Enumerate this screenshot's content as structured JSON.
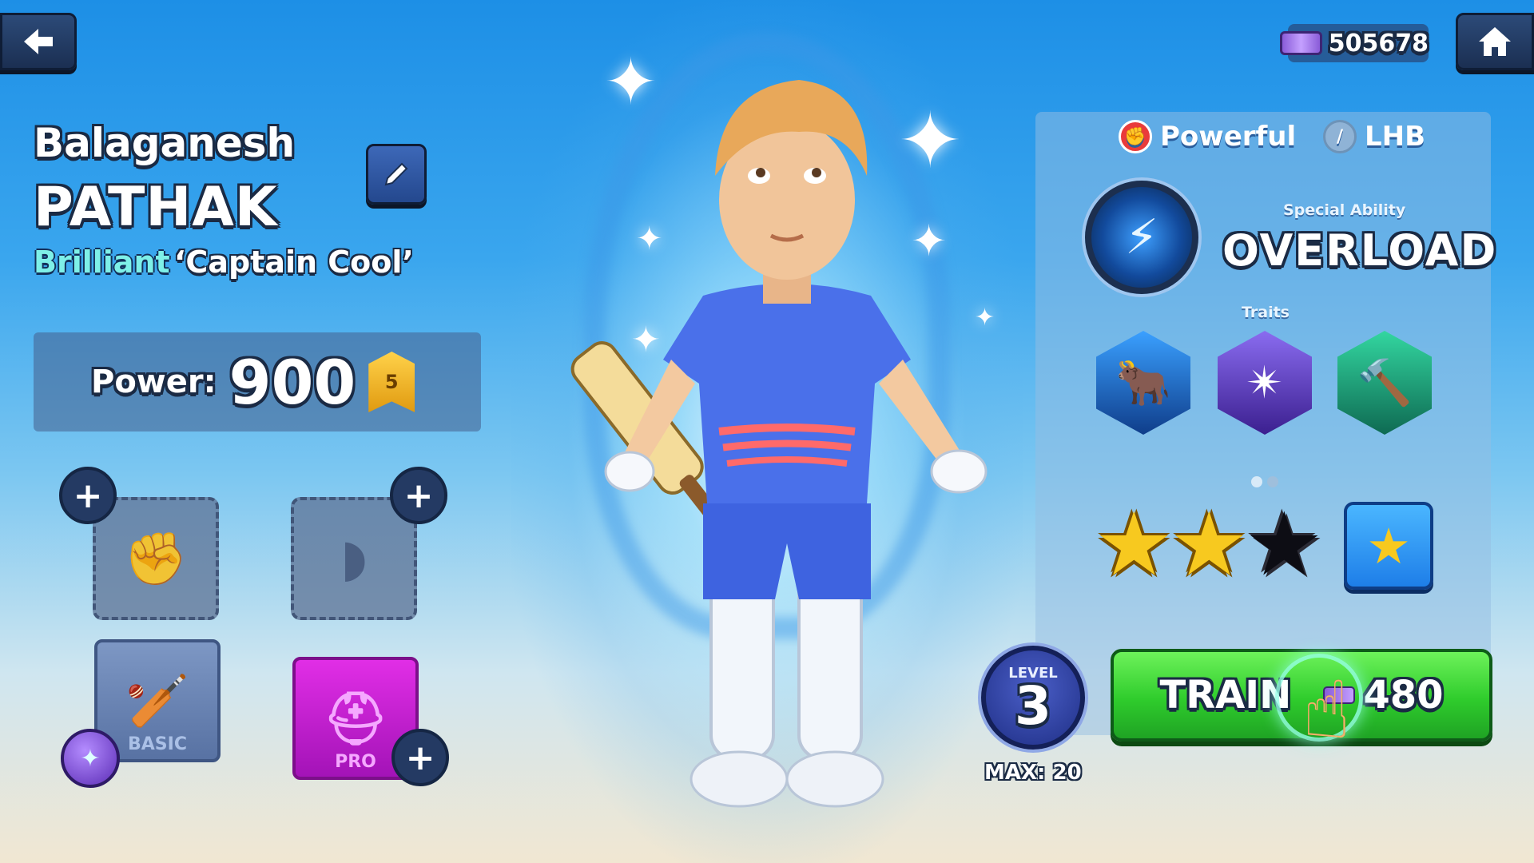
{
  "top_bar": {
    "currency_value": "505678",
    "back_icon": "back-arrow-icon",
    "home_icon": "home-icon"
  },
  "player": {
    "first_name": "Balaganesh",
    "last_name": "PATHAK",
    "tier": "Brilliant",
    "nickname": "‘Captain Cool’",
    "power_label": "Power:",
    "power_value": "900",
    "rank": "5"
  },
  "equipment": {
    "basic_label": "BASIC",
    "pro_label": "PRO"
  },
  "profile": {
    "type_label": "Powerful",
    "hand_label": "LHB",
    "special_ability_caption": "Special Ability",
    "special_ability_name": "OVERLOAD",
    "traits_caption": "Traits",
    "stars_filled": 2,
    "stars_total": 3
  },
  "level": {
    "caption": "LEVEL",
    "value": "3",
    "max_label": "MAX: 20"
  },
  "train": {
    "label": "TRAIN",
    "cost": "480"
  },
  "colors": {
    "train_green": "#2fcc2c",
    "tier_cyan": "#7ef0e8",
    "pro_magenta": "#c21fd0",
    "star_gold": "#f7c91f"
  }
}
